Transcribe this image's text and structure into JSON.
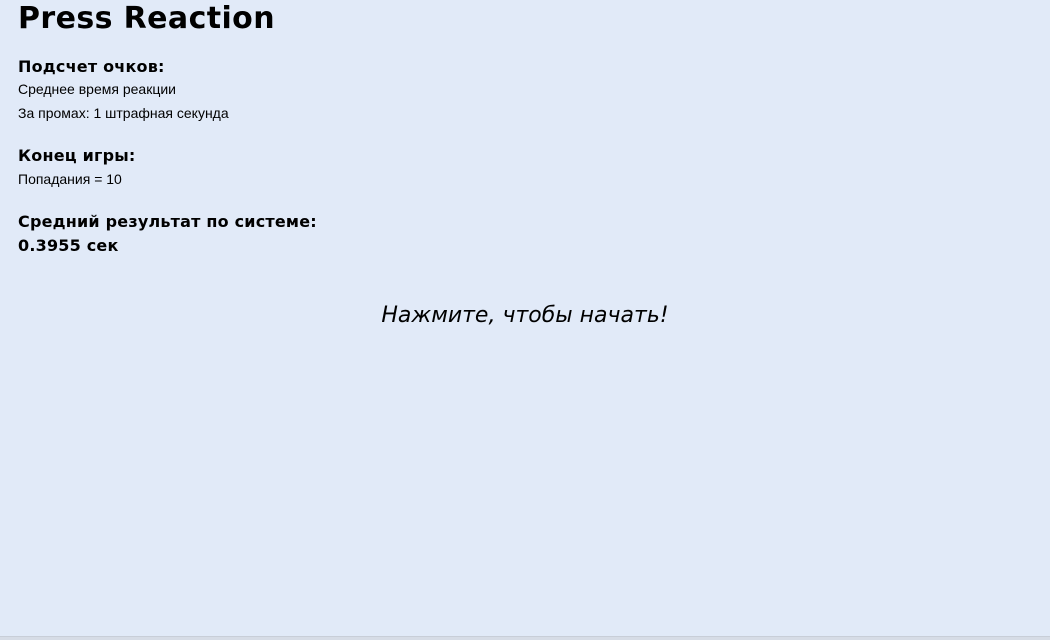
{
  "app": {
    "title": "Press Reaction"
  },
  "scoring": {
    "heading": "Подсчет очков:",
    "lines": [
      "Среднее время реакции",
      "За промах: 1 штрафная секунда"
    ]
  },
  "end_game": {
    "heading": "Конец игры:",
    "line": "Попадания = 10"
  },
  "average": {
    "heading": "Средний результат по системе:",
    "value": "0.3955 сек"
  },
  "prompt": {
    "label": "Нажмите, чтобы начать!"
  }
}
